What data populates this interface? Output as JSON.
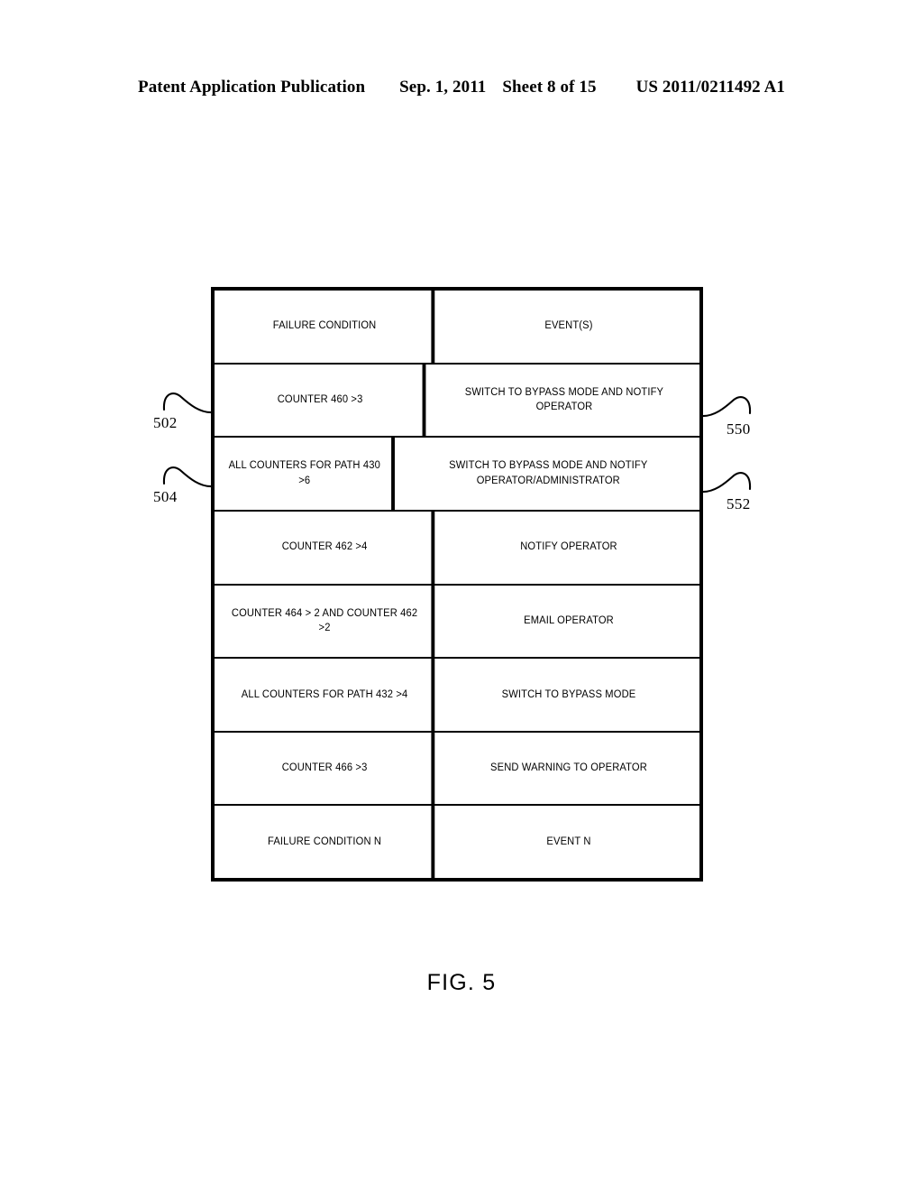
{
  "header": {
    "publication": "Patent Application Publication",
    "date": "Sep. 1, 2011",
    "sheet": "Sheet 8 of 15",
    "patent_number": "US 2011/0211492 A1"
  },
  "figure": {
    "caption": "FIG. 5",
    "table": {
      "columns": [
        "FAILURE CONDITION",
        "EVENT(S)"
      ],
      "rows": [
        {
          "condition": "COUNTER 460 >3",
          "event": "SWITCH TO BYPASS MODE AND NOTIFY OPERATOR"
        },
        {
          "condition": "ALL COUNTERS FOR PATH 430 >6",
          "event": "SWITCH TO BYPASS MODE AND NOTIFY OPERATOR/ADMINISTRATOR"
        },
        {
          "condition": "COUNTER 462 >4",
          "event": "NOTIFY OPERATOR"
        },
        {
          "condition": "COUNTER 464 > 2 AND COUNTER 462 >2",
          "event": "EMAIL OPERATOR"
        },
        {
          "condition": "ALL COUNTERS FOR PATH 432 >4",
          "event": "SWITCH TO BYPASS MODE"
        },
        {
          "condition": "COUNTER 466 >3",
          "event": "SEND WARNING TO OPERATOR"
        },
        {
          "condition": "FAILURE CONDITION N",
          "event": "EVENT N"
        }
      ]
    },
    "reference_numerals": {
      "left": [
        {
          "id": "502"
        },
        {
          "id": "504"
        }
      ],
      "right": [
        {
          "id": "550"
        },
        {
          "id": "552"
        }
      ]
    }
  }
}
